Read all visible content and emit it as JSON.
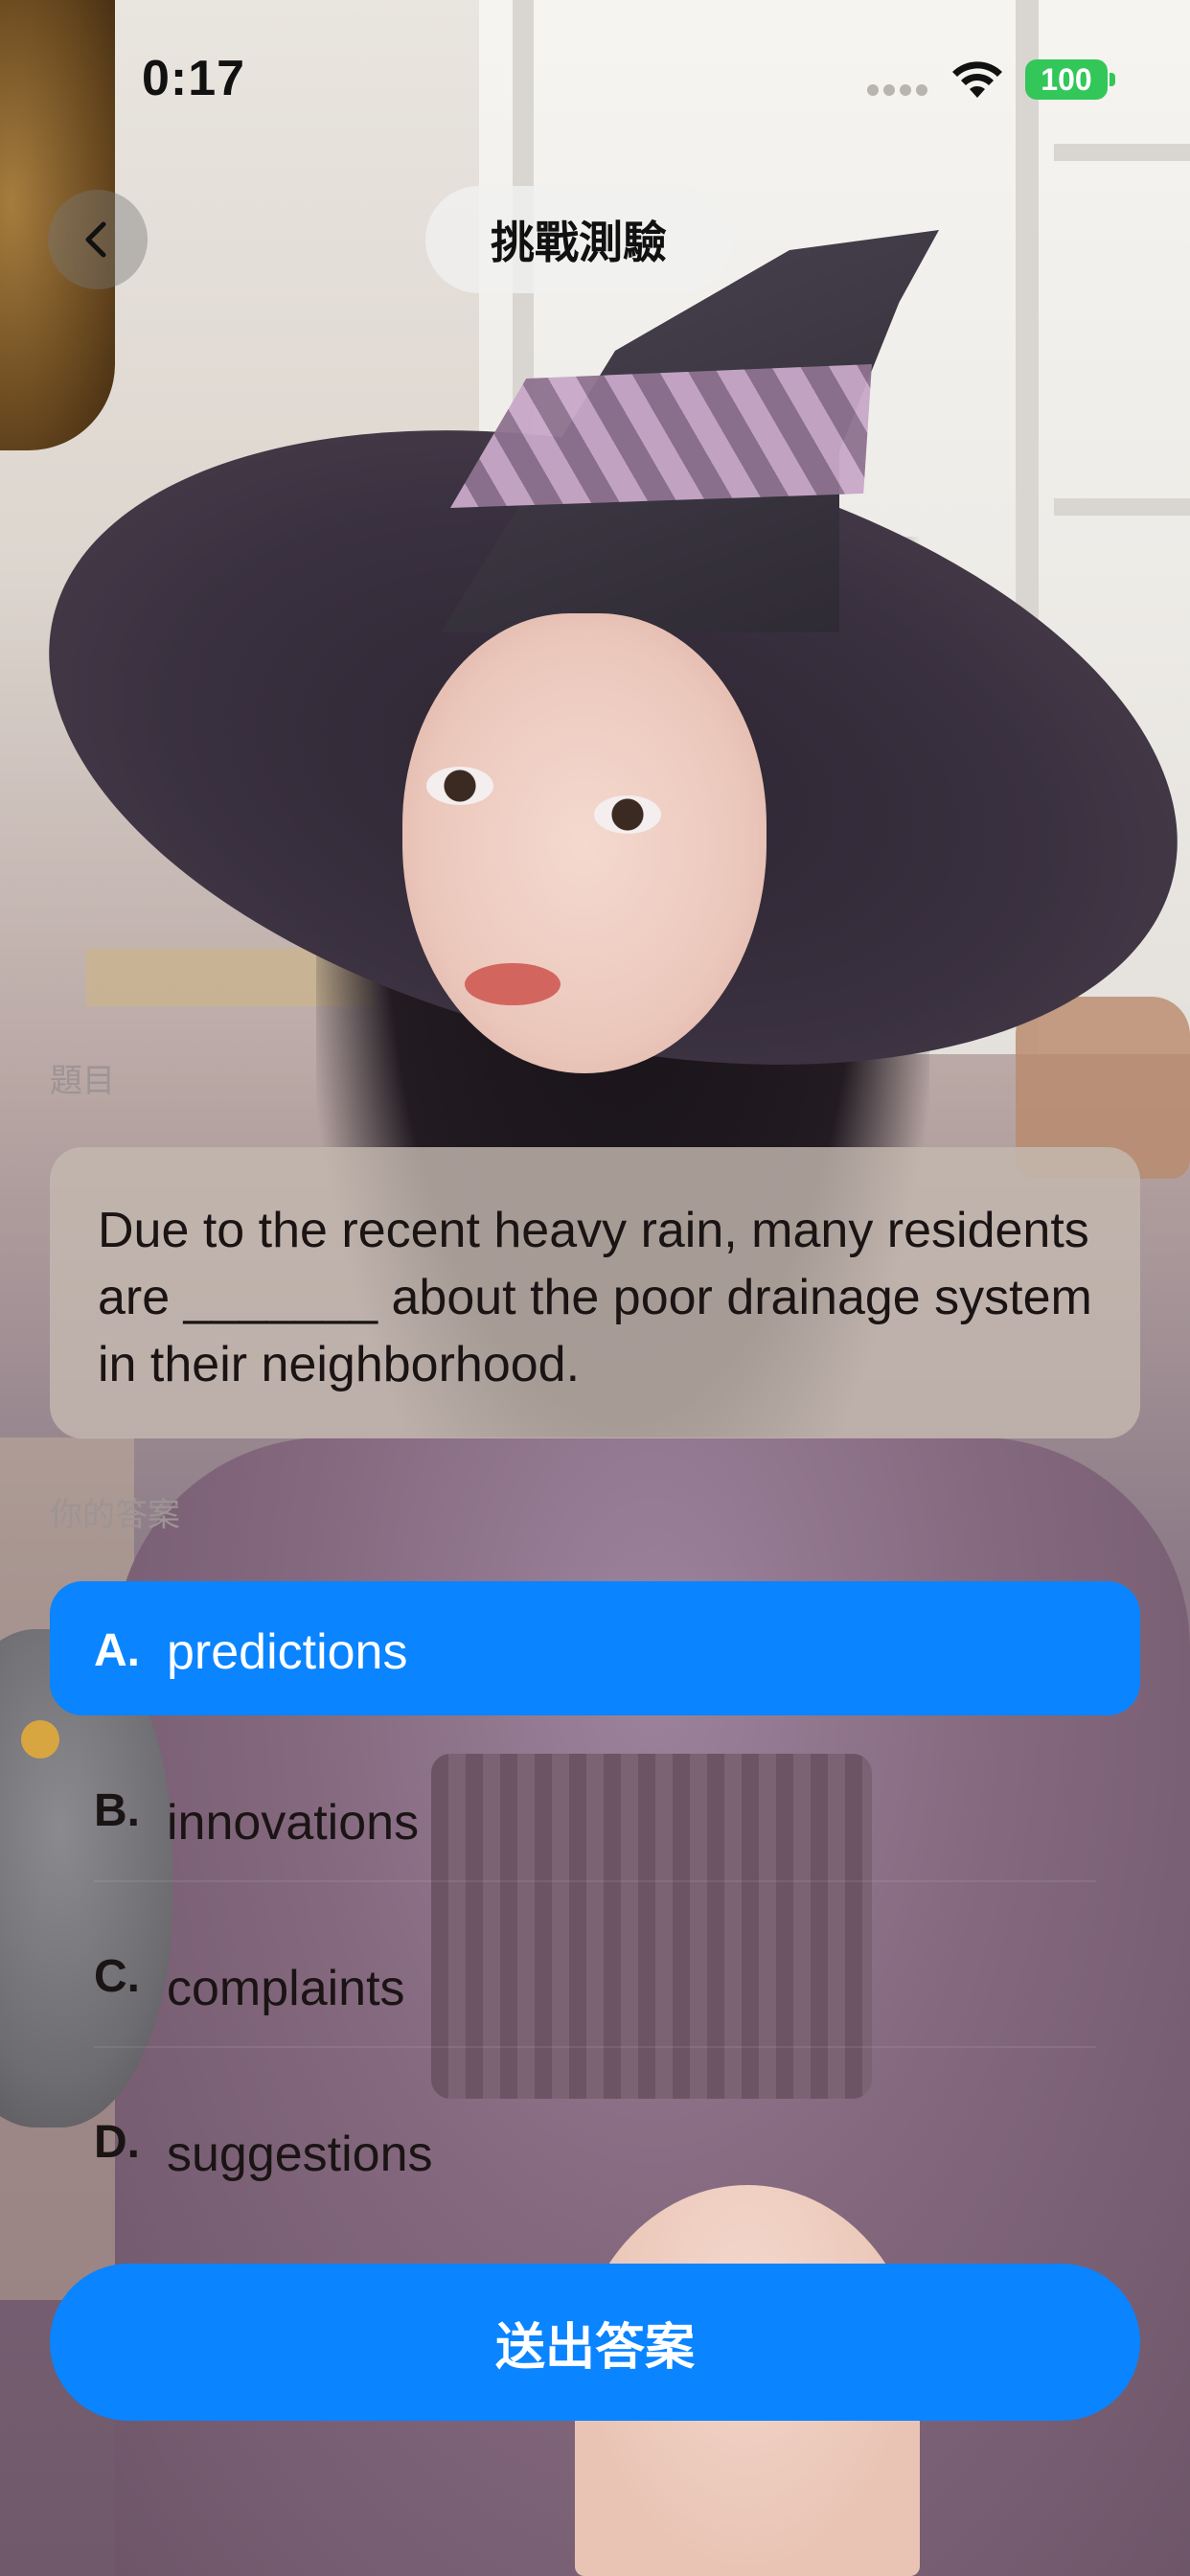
{
  "status_bar": {
    "time": "0:17",
    "battery": "100"
  },
  "nav": {
    "back_icon": "chevron-left-icon",
    "title": "挑戰測驗"
  },
  "question_section": {
    "label": "題目",
    "text": "Due to the recent heavy rain, many residents are _______ about the poor drainage system in their neighborhood."
  },
  "answer_section": {
    "label": "你的答案",
    "selected": "A",
    "options": [
      {
        "letter": "A.",
        "text": "predictions"
      },
      {
        "letter": "B.",
        "text": "innovations"
      },
      {
        "letter": "C.",
        "text": "complaints"
      },
      {
        "letter": "D.",
        "text": "suggestions"
      }
    ]
  },
  "submit": {
    "label": "送出答案"
  },
  "colors": {
    "accent": "#0a84ff",
    "battery": "#33c759"
  }
}
